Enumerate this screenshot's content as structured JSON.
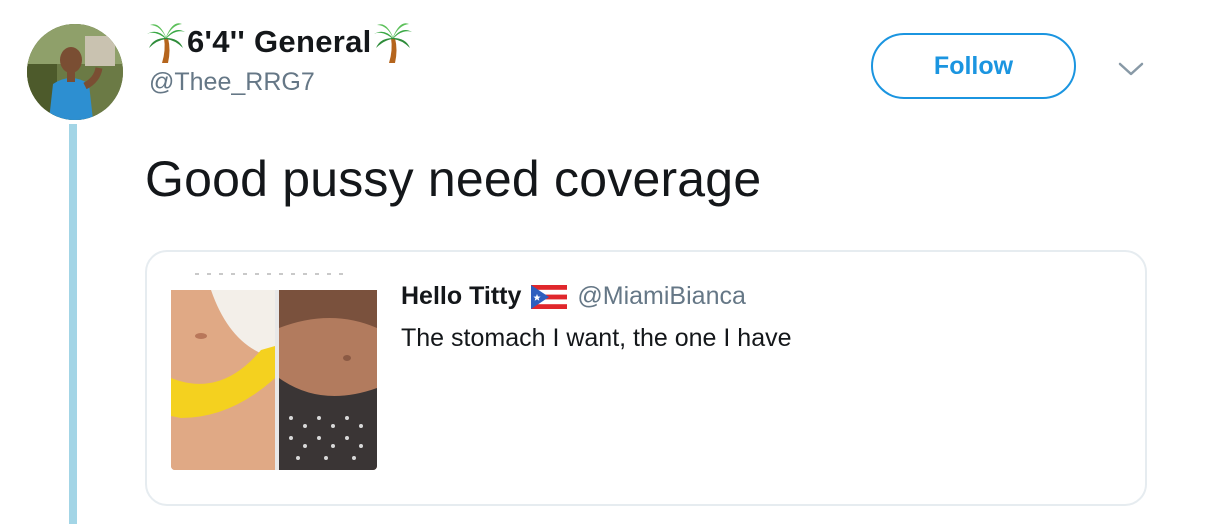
{
  "author": {
    "display_name": "6'4'' General",
    "handle": "@Thee_RRG7",
    "name_emoji": "palm-tree-icon",
    "avatar": "user-avatar-photo"
  },
  "actions": {
    "follow_label": "Follow",
    "more_icon": "chevron-down-icon"
  },
  "tweet": {
    "text": "Good pussy need coverage"
  },
  "quoted": {
    "display_name": "Hello Titty",
    "flag_emoji": "puerto-rico-flag-icon",
    "handle": "@MiamiBianca",
    "text": "The stomach I want, the one I have",
    "media": "quoted-tweet-photo"
  },
  "colors": {
    "accent": "#1b95e0",
    "thread_line": "#a3d5e6",
    "text_primary": "#14171a",
    "text_secondary": "#657786",
    "card_border": "#e6ecf0"
  }
}
